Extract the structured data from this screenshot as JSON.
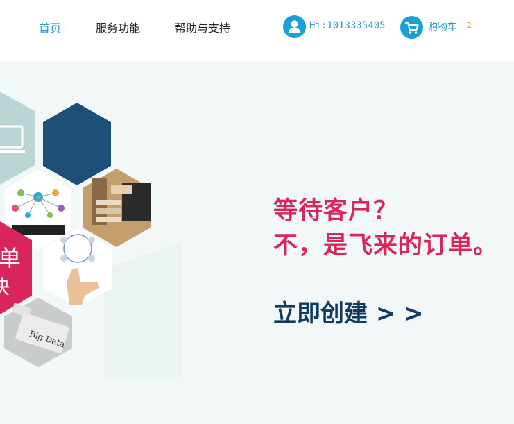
{
  "nav": {
    "home": "首页",
    "services": "服务功能",
    "help": "帮助与支持"
  },
  "user": {
    "greeting": "Hi:1013335405",
    "icon": "user-icon"
  },
  "cart": {
    "label": "购物车",
    "count": "2",
    "icon": "cart-icon"
  },
  "banner": {
    "headline_line1": "等待客户？",
    "headline_line2": "不，是飞来的订单。",
    "cta_label": "立即创建 > >",
    "hex_text_1": "单",
    "hex_text_2": "快",
    "bigdata_label": "Big Data",
    "colors": {
      "accent_red": "#d9265a",
      "navy": "#0f3b63",
      "link_blue": "#2a98c8",
      "hex_navy": "#1e4f78",
      "hex_pink": "#d8265c"
    }
  }
}
